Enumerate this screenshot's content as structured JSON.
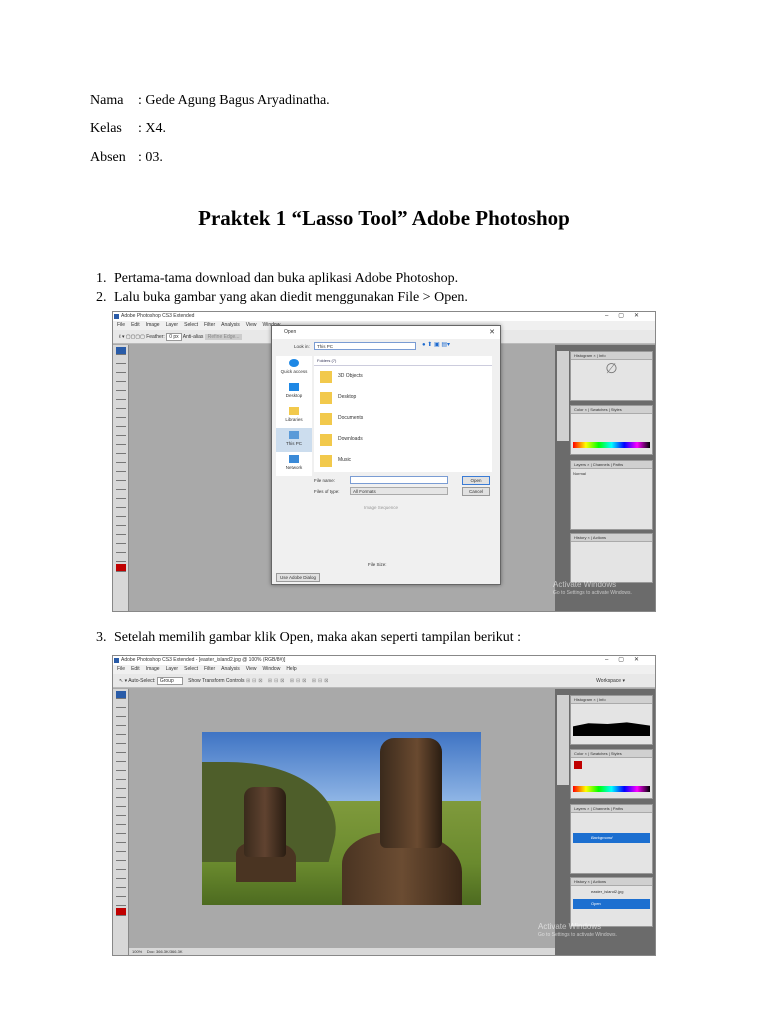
{
  "info": [
    {
      "label": "Nama",
      "value": ": Gede Agung Bagus Aryadinatha."
    },
    {
      "label": "Kelas",
      "value": ": X4."
    },
    {
      "label": "Absen",
      "value": ": 03."
    }
  ],
  "title": "Praktek 1 “Lasso Tool” Adobe Photoshop",
  "steps": [
    {
      "num": "1.",
      "text": "Pertama-tama download dan buka aplikasi Adobe Photoshop."
    },
    {
      "num": "2.",
      "text": "Lalu buka gambar yang akan diedit menggunakan File > Open."
    },
    {
      "num": "3.",
      "text": "Setelah memilih gambar klik Open, maka akan seperti tampilan berikut :"
    }
  ],
  "shot1": {
    "window_title": "Adobe Photoshop CS3 Extended",
    "menu": [
      "File",
      "Edit",
      "Image",
      "Layer",
      "Select",
      "Filter",
      "Analysis",
      "View",
      "Window"
    ],
    "options": {
      "feather_label": "Feather:",
      "feather_value": "0 px",
      "antialias": "Anti-alias",
      "refine": "Refine Edge..."
    },
    "dialog": {
      "title": "Open",
      "look_in_label": "Look in:",
      "look_in_value": "This PC",
      "places": [
        "Quick access",
        "Desktop",
        "Libraries",
        "This PC",
        "Network"
      ],
      "group": "Folders (7)",
      "folders": [
        "3D Objects",
        "Desktop",
        "Documents",
        "Downloads",
        "Music"
      ],
      "file_name_label": "File name:",
      "file_name_value": "",
      "file_type_label": "Files of type:",
      "file_type_value": "All Formats",
      "open": "Open",
      "cancel": "Cancel",
      "image_sequence": "Image Sequence",
      "file_size": "File Size:",
      "adobe_dialog": "Use Adobe Dialog"
    },
    "panels": {
      "nav": "Histogram × | Info",
      "color": "Color × | Swatches | Styles",
      "layers": "Layers × | Channels | Paths",
      "layers_mode": "Normal",
      "history": "History × | Actions"
    },
    "watermark": [
      "Activate Windows",
      "Go to Settings to activate Windows."
    ]
  },
  "shot2": {
    "window_title": "Adobe Photoshop CS3 Extended - [easter_island2.jpg @ 100% (RGB/8#)]",
    "menu": [
      "File",
      "Edit",
      "Image",
      "Layer",
      "Select",
      "Filter",
      "Analysis",
      "View",
      "Window",
      "Help"
    ],
    "options": {
      "auto_select": "Auto-Select:",
      "auto_select_value": "Group",
      "transform": "Show Transform Controls",
      "workspace": "Workspace ▾"
    },
    "panels": {
      "nav": "Histogram × | Info",
      "color": "Color × | Swatches | Styles",
      "layers": "Layers × | Channels | Paths",
      "layer_name": "Background",
      "history": "History × | Actions",
      "history_file": "easter_island2.jpg",
      "history_step": "Open"
    },
    "status": {
      "zoom": "100%",
      "doc": "Doc: 366.3K/366.3K"
    },
    "watermark": [
      "Activate Windows",
      "Go to Settings to activate Windows."
    ]
  }
}
